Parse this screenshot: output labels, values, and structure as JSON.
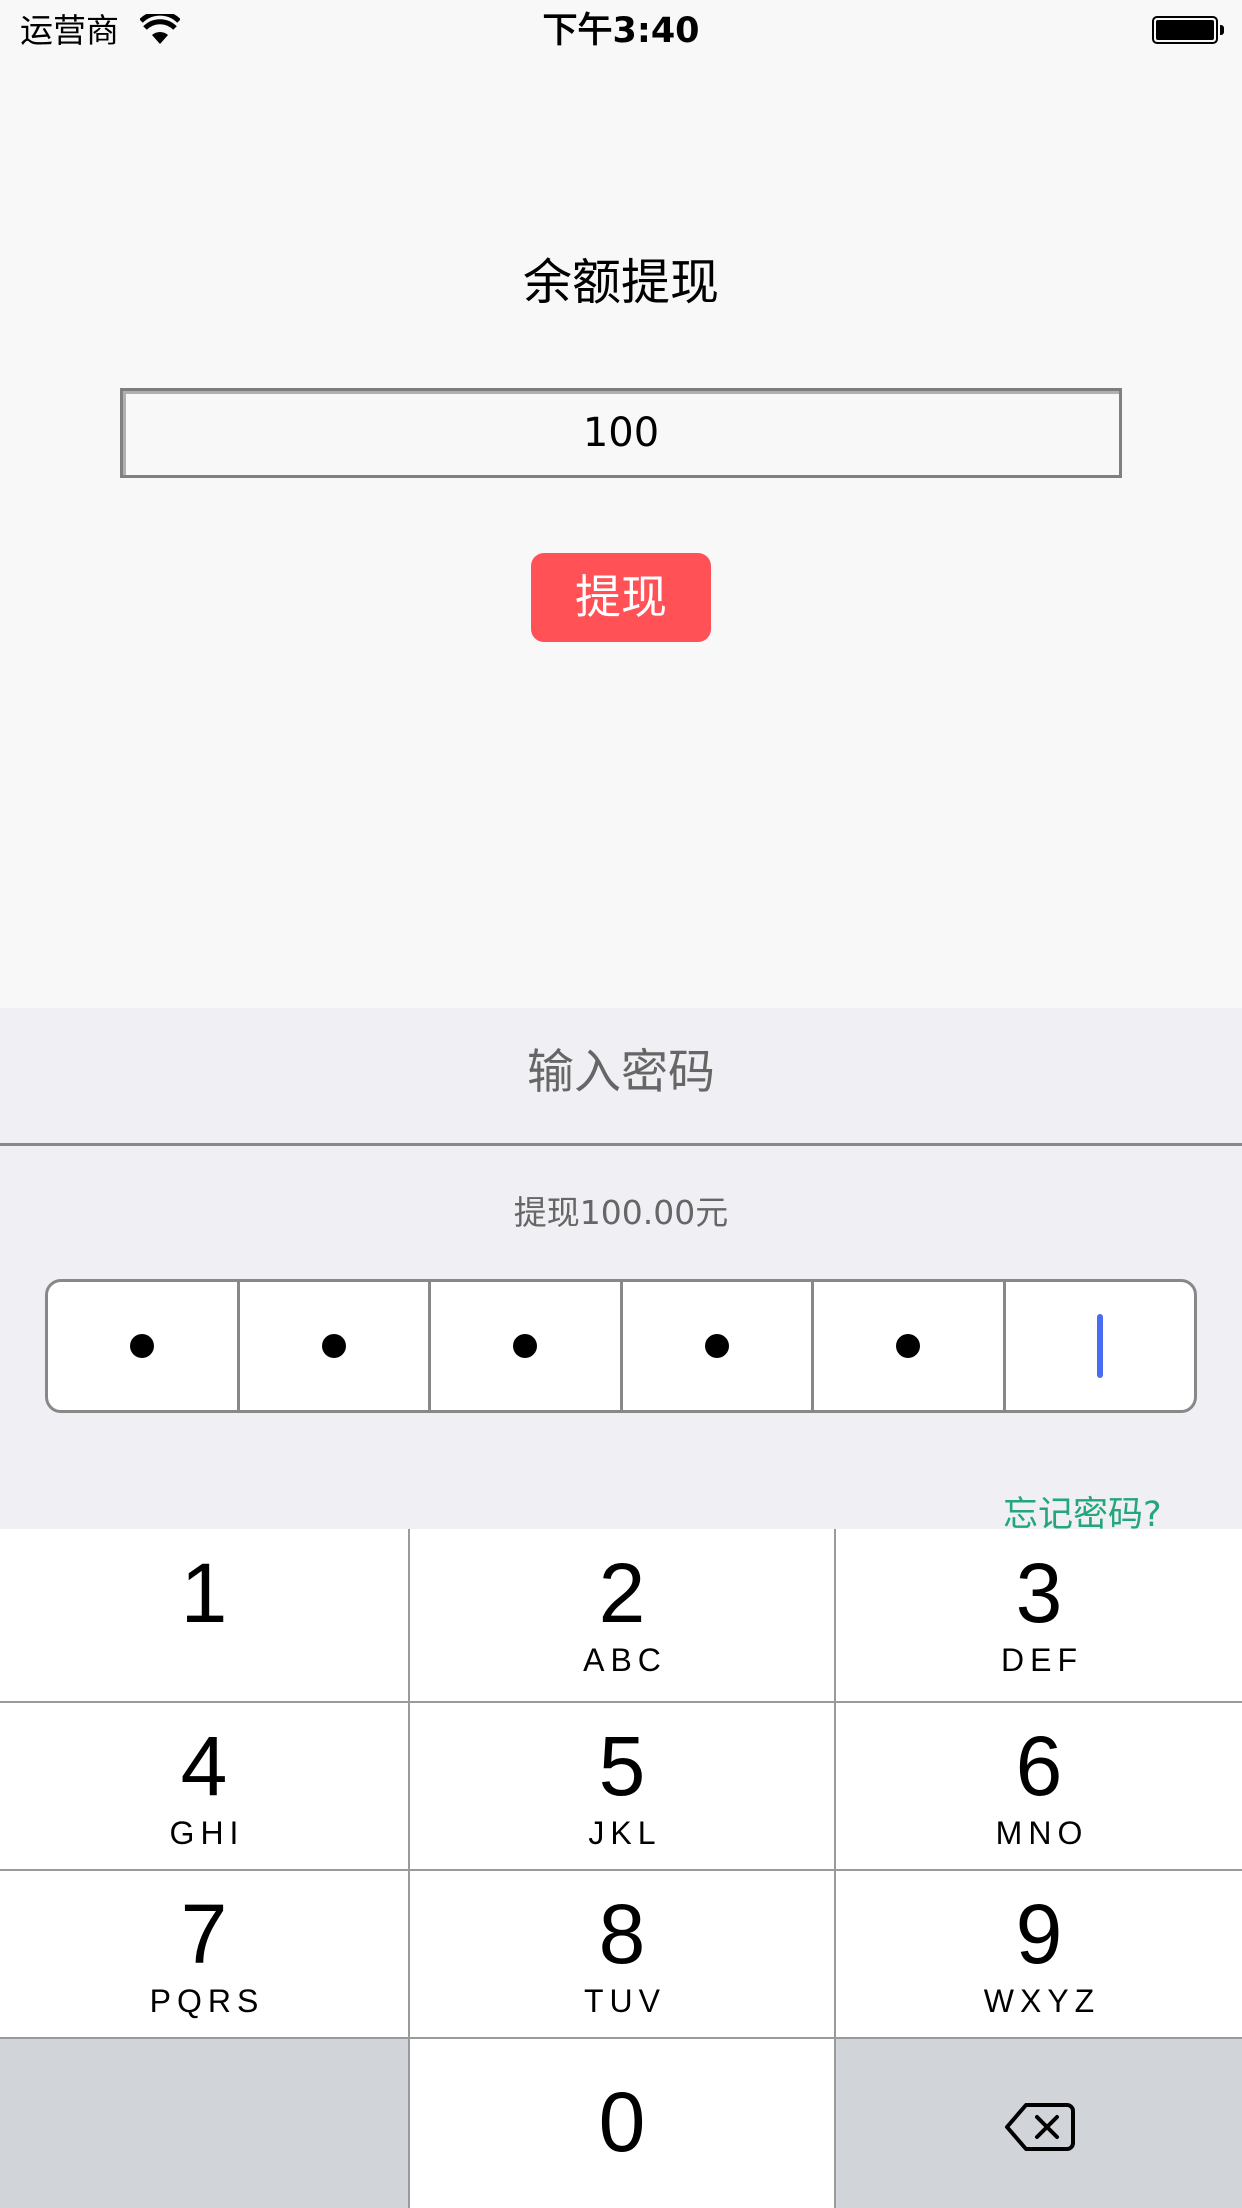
{
  "status_bar": {
    "carrier": "运营商",
    "time": "下午3:40",
    "wifi_icon": "wifi-icon",
    "battery_icon": "battery-full-icon",
    "battery_level": 1.0
  },
  "main": {
    "title": "余额提现",
    "amount_input": {
      "value": "100",
      "placeholder": ""
    },
    "withdraw_button": "提现",
    "accent_color": "#ff5156"
  },
  "password_sheet": {
    "title": "输入密码",
    "subtitle": "提现100.00元",
    "pin_length": 6,
    "digits_entered": 5,
    "mask_char": "•",
    "forgot_link": "忘记密码?",
    "forgot_color": "#22a67a",
    "cursor_color": "#4a6cf0"
  },
  "keyboard": {
    "keys": [
      {
        "digit": "1",
        "letters": ""
      },
      {
        "digit": "2",
        "letters": "ABC"
      },
      {
        "digit": "3",
        "letters": "DEF"
      },
      {
        "digit": "4",
        "letters": "GHI"
      },
      {
        "digit": "5",
        "letters": "JKL"
      },
      {
        "digit": "6",
        "letters": "MNO"
      },
      {
        "digit": "7",
        "letters": "PQRS"
      },
      {
        "digit": "8",
        "letters": "TUV"
      },
      {
        "digit": "9",
        "letters": "WXYZ"
      },
      {
        "digit": "",
        "letters": ""
      },
      {
        "digit": "0",
        "letters": ""
      },
      {
        "digit": "",
        "letters": "",
        "icon": "backspace-icon"
      }
    ]
  }
}
